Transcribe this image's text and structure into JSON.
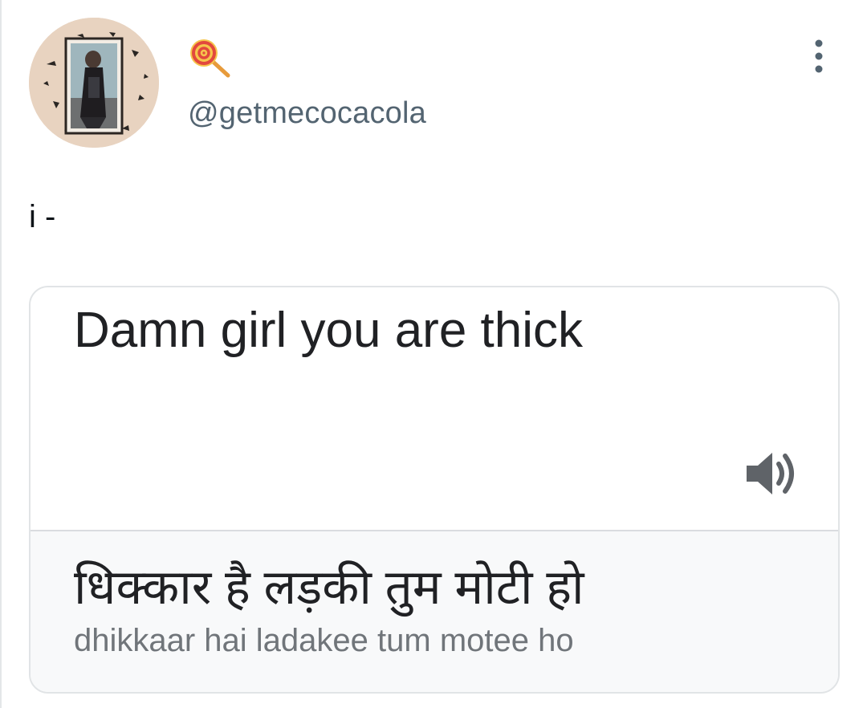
{
  "author": {
    "name_icon": "lollipop-icon",
    "handle": "@getmecocacola",
    "avatar": "profile-photo"
  },
  "tweet": {
    "text": "i -"
  },
  "translation_card": {
    "source_text": "Damn girl you are thick",
    "speaker_icon": "speaker-icon",
    "translated_text": "धिक्कार है लड़की तुम मोटी हो",
    "romanized_text": "dhikkaar hai ladakee tum motee ho"
  },
  "colors": {
    "handle": "#536471",
    "text": "#0f1419",
    "card_border": "#e1e4e6",
    "card_bottom_bg": "#f8f9fa",
    "translation_text": "#202124",
    "romanized_text": "#70757a"
  }
}
